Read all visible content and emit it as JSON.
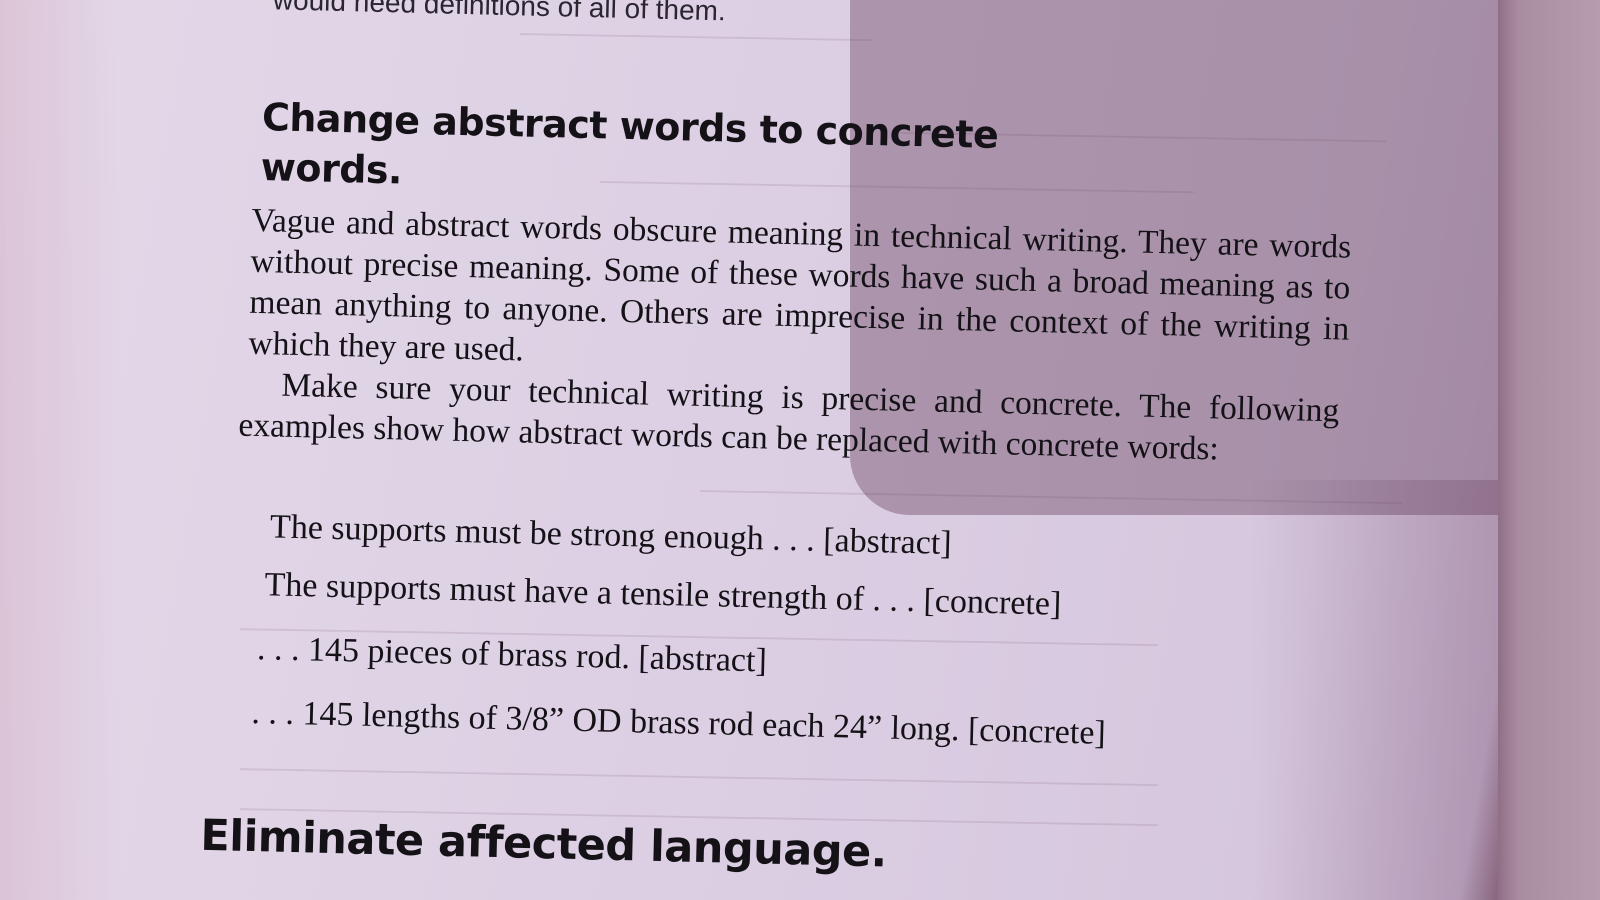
{
  "page": {
    "cut_off_top_line": "would need definitions of all of them.",
    "section_heading": "Change abstract words to concrete words.",
    "paragraphs": [
      "Vague and abstract words obscure meaning in technical writing. They are words without precise meaning. Some of these words have such a broad meaning as to mean anything to anyone. Others are imprecise in the context of the writing in which they are used.",
      "Make sure your technical writing is precise and concrete. The following examples show how abstract words can be replaced with concrete words:"
    ],
    "examples": [
      "The supports must be strong enough . . . [abstract]",
      "The supports must have a tensile strength of . . . [concrete]",
      ". . . 145 pieces of brass rod. [abstract]",
      ". . . 145 lengths of 3/8” OD brass rod each 24” long. [concrete]"
    ],
    "next_heading": "Eliminate affected language."
  },
  "colors": {
    "paper": "#ddd0e4",
    "shadow": "#8f6f86",
    "ink": "#141217"
  }
}
